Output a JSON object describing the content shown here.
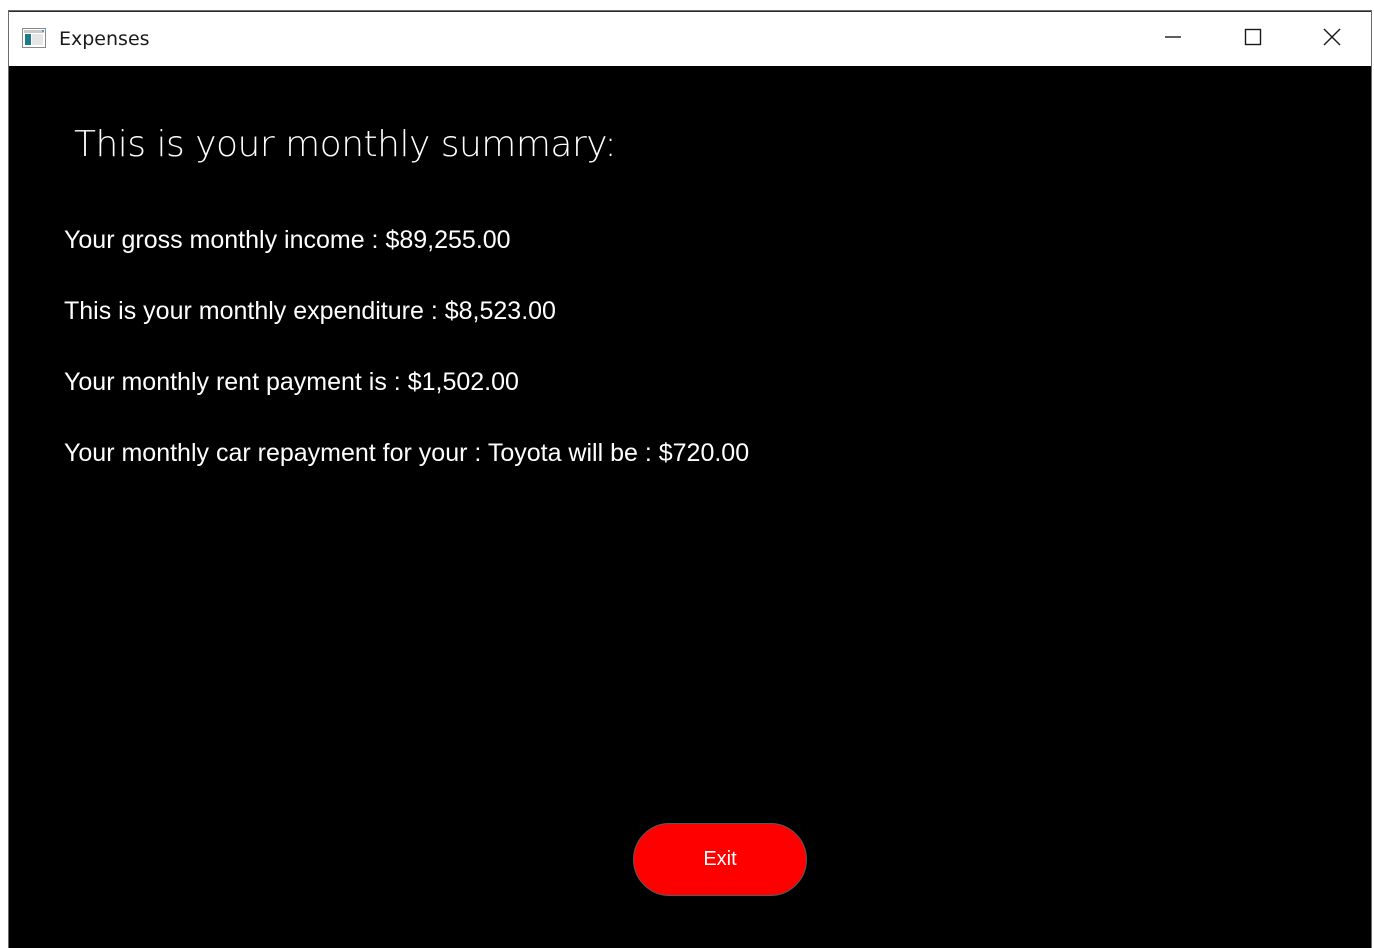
{
  "window": {
    "title": "Expenses",
    "icon": "app-window-icon",
    "caption_buttons": [
      "minimize-icon",
      "maximize-icon",
      "close-icon"
    ]
  },
  "summary": {
    "heading": "This is your monthly summary:",
    "lines": [
      "Your gross monthly income : $89,255.00",
      "This is your monthly expenditure : $8,523.00",
      "Your monthly rent payment is : $1,502.00",
      "Your monthly car repayment for your : Toyota will be : $720.00"
    ]
  },
  "actions": {
    "exit_label": "Exit"
  },
  "colors": {
    "background": "#000000",
    "text": "#ffffff",
    "exit_button": "#ff0000",
    "titlebar": "#ffffff"
  }
}
